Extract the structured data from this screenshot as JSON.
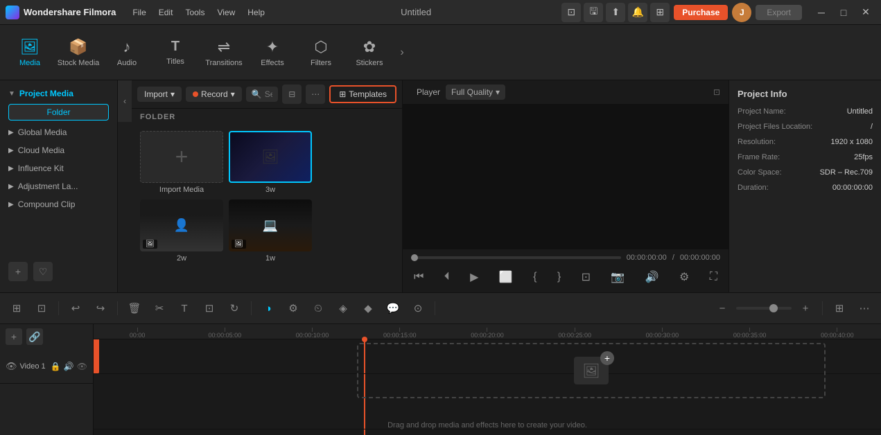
{
  "app": {
    "name": "Wondershare Filmora",
    "title": "Untitled"
  },
  "titlebar": {
    "menus": [
      "File",
      "Edit",
      "Tools",
      "View",
      "Help"
    ],
    "purchase_label": "Purchase",
    "export_label": "Export",
    "user_initial": "J"
  },
  "toolbar": {
    "items": [
      {
        "id": "media",
        "label": "Media",
        "icon": "🖼"
      },
      {
        "id": "stock",
        "label": "Stock Media",
        "icon": "📦"
      },
      {
        "id": "audio",
        "label": "Audio",
        "icon": "🎵"
      },
      {
        "id": "titles",
        "label": "Titles",
        "icon": "T"
      },
      {
        "id": "transitions",
        "label": "Transitions",
        "icon": "⟷"
      },
      {
        "id": "effects",
        "label": "Effects",
        "icon": "✨"
      },
      {
        "id": "filters",
        "label": "Filters",
        "icon": "🎨"
      },
      {
        "id": "stickers",
        "label": "Stickers",
        "icon": "⭐"
      }
    ],
    "more_icon": "›"
  },
  "sidebar": {
    "header": "Project Media",
    "folder_btn": "Folder",
    "items": [
      {
        "label": "Global Media"
      },
      {
        "label": "Cloud Media"
      },
      {
        "label": "Influence Kit"
      },
      {
        "label": "Adjustment La..."
      },
      {
        "label": "Compound Clip"
      }
    ]
  },
  "media_toolbar": {
    "import_label": "Import",
    "record_label": "Record",
    "search_placeholder": "Search media",
    "templates_label": "Templates"
  },
  "media_panel": {
    "folder_label": "FOLDER",
    "items": [
      {
        "label": "Import Media",
        "type": "add"
      },
      {
        "label": "3w",
        "type": "thumb-dark-blue"
      },
      {
        "label": "2w",
        "type": "thumb-person"
      },
      {
        "label": "1w",
        "type": "thumb-code"
      }
    ]
  },
  "preview": {
    "tab_label": "Player",
    "quality": "Full Quality",
    "time_current": "00:00:00:00",
    "time_total": "00:00:00:00"
  },
  "project_info": {
    "title": "Project Info",
    "name_label": "Project Name:",
    "name_value": "Untitled",
    "files_label": "Project Files Location:",
    "files_value": "/",
    "resolution_label": "Resolution:",
    "resolution_value": "1920 x 1080",
    "framerate_label": "Frame Rate:",
    "framerate_value": "25fps",
    "colorspace_label": "Color Space:",
    "colorspace_value": "SDR – Rec.709",
    "duration_label": "Duration:",
    "duration_value": "00:00:00:00"
  },
  "timeline": {
    "rulers": [
      "00:00",
      "00:00:05:00",
      "00:00:10:00",
      "00:00:15:00",
      "00:00:20:00",
      "00:00:25:00",
      "00:00:30:00",
      "00:00:35:00",
      "00:00:40:00"
    ],
    "tracks": [
      {
        "name": "Video 1",
        "type": "video"
      }
    ],
    "drag_drop_text": "Drag and drop media and effects here to create your video."
  }
}
